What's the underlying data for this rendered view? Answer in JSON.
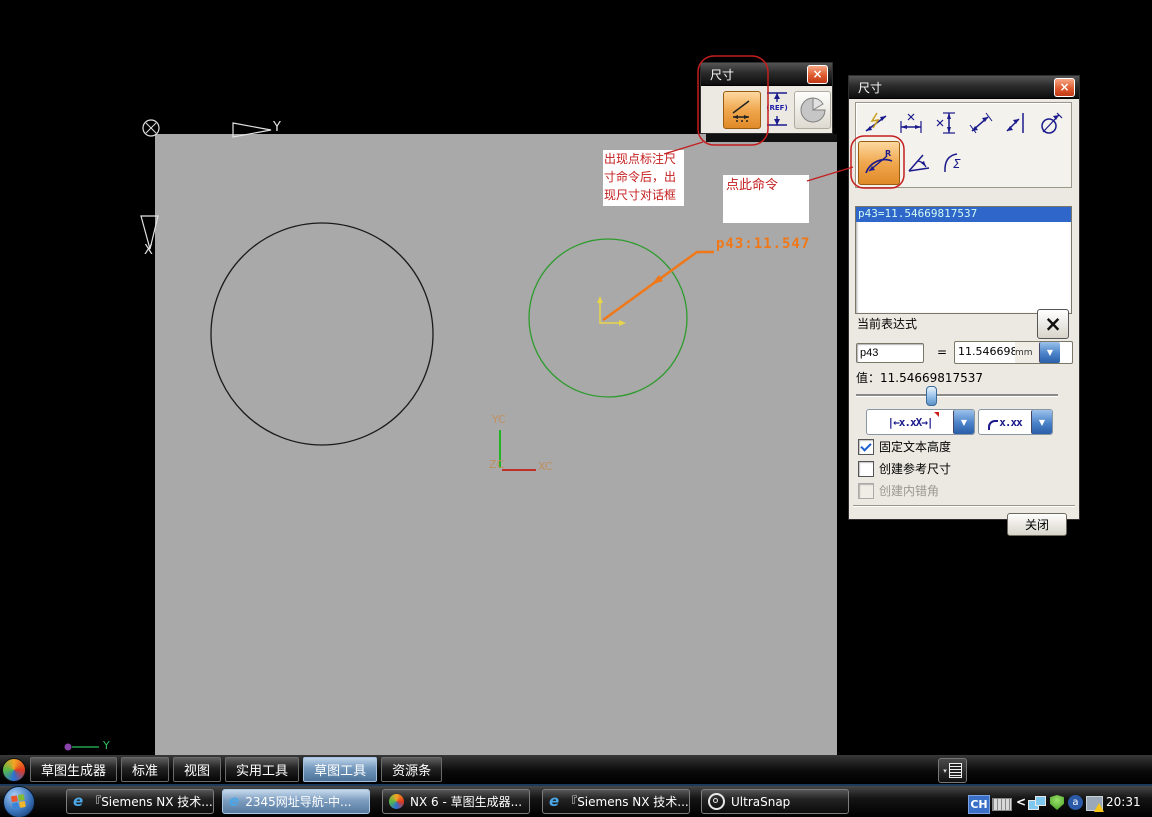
{
  "colors": {
    "plane_gray": "#a9a9a9",
    "green_circle": "#2e9b2e",
    "black_circle": "#1a1a1a",
    "orange_dimension": "#f07818",
    "annotation_red": "#c41e1e",
    "selection_blue": "#2f66c9",
    "active_tab_blue": "#7499bd"
  },
  "sketch": {
    "dimension_text": "p43:11.547",
    "labels": {
      "plane_y": "Y",
      "plane_x": "X",
      "yc": "YC",
      "zc": "ZC",
      "xc": "XC",
      "wcs_y": "Y"
    }
  },
  "annotations": {
    "note1": "出现点标注尺\n寸命令后，出\n现尺寸对话框",
    "note2": "点此命令"
  },
  "mini_dialog": {
    "title": "尺寸",
    "ref_label": "(REF)",
    "buttons": [
      "linear-dimension",
      "reference-dimension",
      "perimeter-dimension"
    ]
  },
  "dim_dialog": {
    "title": "尺寸",
    "toolbar_row1": [
      "inferred-dimension",
      "horizontal-dimension",
      "vertical-dimension",
      "parallel-dimension",
      "perpendicular-dimension",
      "diameter-dimension"
    ],
    "toolbar_row2": [
      "radius-dimension",
      "angular-dimension",
      "perimeter-dimension"
    ],
    "radius_letter": "R",
    "sigma": "Σ",
    "expressions": [
      {
        "text": "p43=11.54669817537"
      }
    ],
    "current_expression_label": "当前表达式",
    "name_field": "p43",
    "equals": "=",
    "value_field": "11.546698",
    "unit": "mm",
    "value_label": "值：11.54669817537",
    "style_combo_label": "|←x.xX→|",
    "angle_combo_label": "x.xx",
    "checkboxes": [
      {
        "label": "固定文本高度",
        "checked": true,
        "disabled": false
      },
      {
        "label": "创建参考尺寸",
        "checked": false,
        "disabled": false
      },
      {
        "label": "创建内错角",
        "checked": false,
        "disabled": true
      }
    ],
    "close_button": "关闭"
  },
  "tab_bar": {
    "tabs": [
      {
        "label": "草图生成器",
        "active": false
      },
      {
        "label": "标准",
        "active": false
      },
      {
        "label": "视图",
        "active": false
      },
      {
        "label": "实用工具",
        "active": false
      },
      {
        "label": "草图工具",
        "active": true
      },
      {
        "label": "资源条",
        "active": false
      }
    ]
  },
  "taskbar": {
    "buttons": [
      {
        "label": "『Siemens NX 技术...",
        "icon": "ie",
        "active": false
      },
      {
        "label": "2345网址导航-中...",
        "icon": "ie",
        "active": true
      },
      {
        "label": "NX 6 - 草图生成器...",
        "icon": "nx",
        "active": false
      },
      {
        "label": "『Siemens NX 技术...",
        "icon": "ie",
        "active": false
      },
      {
        "label": "UltraSnap",
        "icon": "ultrasnap",
        "active": false
      }
    ],
    "tray": {
      "ime": "CH",
      "chevron": "<",
      "a_glyph": "a",
      "time": "20:31"
    }
  },
  "icons": {
    "ie_glyph": "e",
    "close_glyph": "×",
    "dropdown_arrow": "▼"
  }
}
